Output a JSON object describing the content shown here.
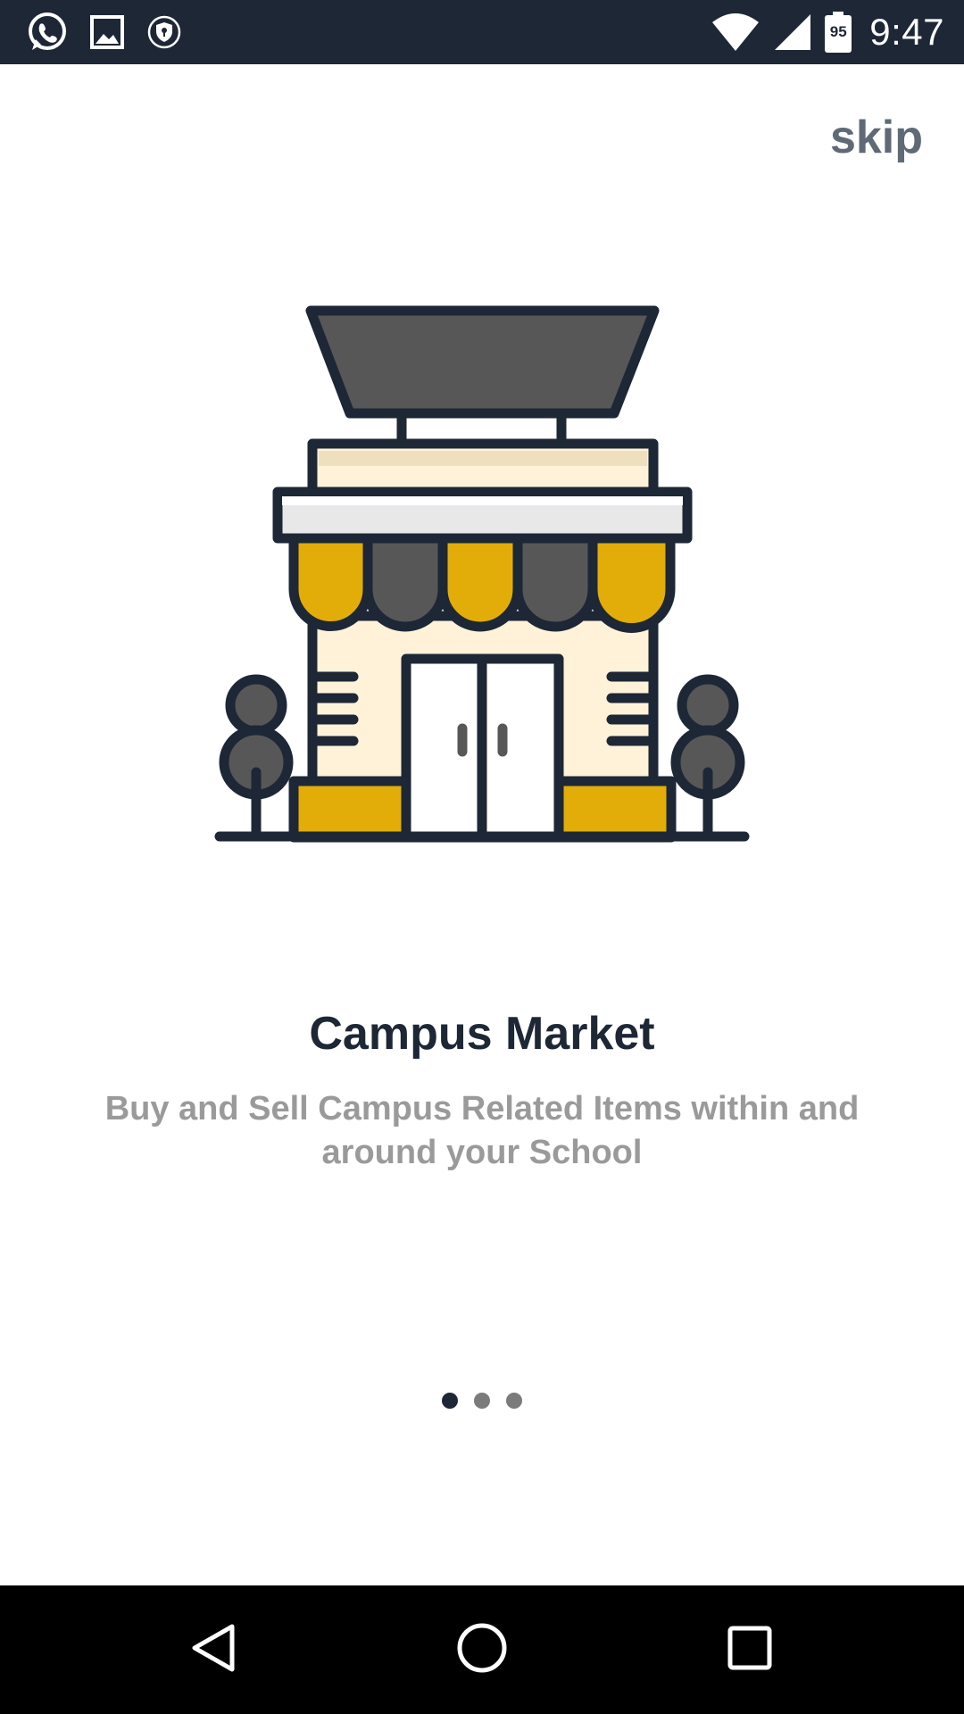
{
  "status_bar": {
    "time": "9:47",
    "battery_level": "95",
    "left_icons": [
      "whatsapp-icon",
      "image-icon",
      "vpn-shield-icon"
    ],
    "right_icons": [
      "wifi-icon",
      "cell-signal-icon",
      "battery-icon"
    ]
  },
  "onboarding": {
    "skip_label": "skip",
    "title": "Campus Market",
    "subtitle": "Buy and Sell Campus Related Items within and around your School",
    "illustration": "storefront-illustration",
    "page_index": 0,
    "page_count": 3
  },
  "colors": {
    "status_bar": "#1d2736",
    "title": "#1d2736",
    "subtitle": "#9a9a9a",
    "skip": "#5f6a76",
    "accent_yellow": "#e2ad08",
    "dark_gray": "#575757",
    "cream": "#fff2d8"
  },
  "nav_bar": {
    "icons": [
      "back-icon",
      "home-icon",
      "recents-icon"
    ]
  }
}
